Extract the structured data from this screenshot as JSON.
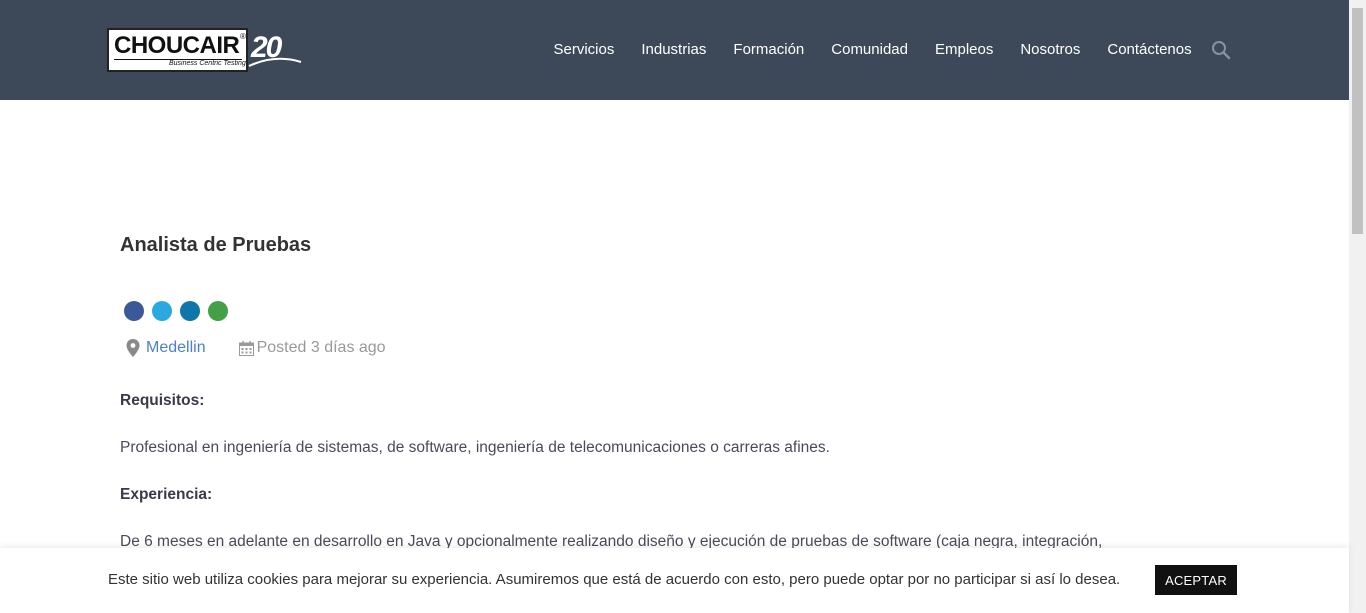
{
  "header": {
    "logo": {
      "word": "CHOUCAIR",
      "reg": "®",
      "tagline": "Business Centric Testing",
      "anniversary": "20"
    },
    "nav": [
      "Servicios",
      "Industrias",
      "Formación",
      "Comunidad",
      "Empleos",
      "Nosotros",
      "Contáctenos"
    ],
    "search_icon": "search-icon",
    "background_color": "#3d4858"
  },
  "job": {
    "title": "Analista de Pruebas",
    "share": [
      {
        "icon": "facebook-icon",
        "color": "#3b5998"
      },
      {
        "icon": "twitter-icon",
        "color": "#2aa9e0"
      },
      {
        "icon": "linkedin-icon",
        "color": "#0e76a8"
      },
      {
        "icon": "whatsapp-icon",
        "color": "#43a047"
      }
    ],
    "location": "Medellin",
    "posted": "Posted 3 días ago",
    "sections": {
      "requirements_heading": "Requisitos:",
      "requirements_text": "Profesional en ingeniería de sistemas, de software, ingeniería de telecomunicaciones o carreras afines.",
      "experience_heading": "Experiencia:",
      "experience_text": "De 6 meses en adelante en desarrollo en Java y opcionalmente realizando diseño y ejecución de pruebas de software (caja negra, integración,"
    }
  },
  "cookie": {
    "text": "Este sitio web utiliza cookies para mejorar su experiencia. Asumiremos que está de acuerdo con esto, pero puede optar por no participar si así lo desea.",
    "button": "ACEPTAR"
  }
}
